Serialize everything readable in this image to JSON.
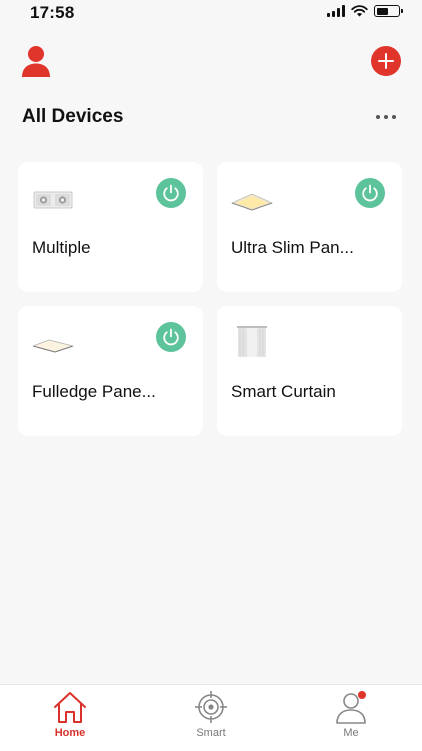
{
  "status_bar": {
    "time": "17:58",
    "battery_level": 0.55
  },
  "header": {
    "section_title": "All Devices"
  },
  "devices": [
    {
      "name": "Multiple",
      "icon": "dual-spotlight-icon",
      "has_power": true
    },
    {
      "name": "Ultra Slim Pan...",
      "icon": "panel-light-icon",
      "has_power": true
    },
    {
      "name": "Fulledge Pane...",
      "icon": "panel-light-icon",
      "has_power": true
    },
    {
      "name": "Smart Curtain",
      "icon": "curtain-icon",
      "has_power": false
    }
  ],
  "tabs": [
    {
      "label": "Home",
      "icon": "home-icon",
      "active": true
    },
    {
      "label": "Smart",
      "icon": "target-icon",
      "active": false
    },
    {
      "label": "Me",
      "icon": "person-icon",
      "active": false,
      "badge": true
    }
  ],
  "colors": {
    "accent": "#e0352b",
    "power": "#5cc39a",
    "background": "#f7f7f7"
  }
}
